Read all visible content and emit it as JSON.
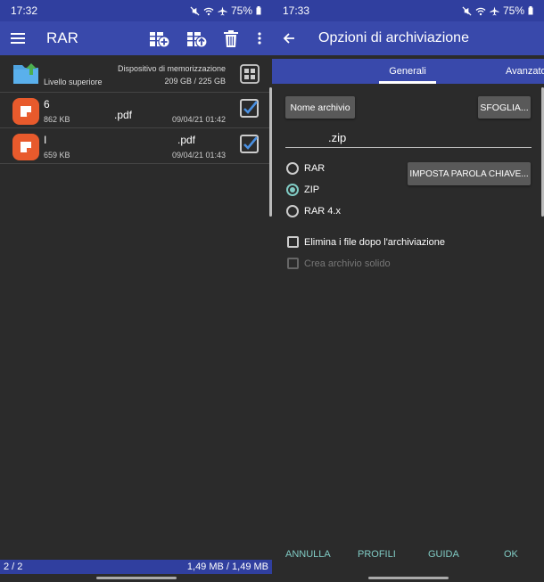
{
  "left": {
    "status": {
      "time": "17:32",
      "battery": "75%"
    },
    "appbar": {
      "title": "RAR"
    },
    "storage": {
      "up_label": "Livello superiore",
      "device_label": "Dispositivo di memorizzazione",
      "space": "209 GB / 225 GB"
    },
    "files": [
      {
        "name_start": "6",
        "name_ext": ".pdf",
        "size": "862 KB",
        "date": "09/04/21 01:42",
        "checked": true
      },
      {
        "name_start": "I",
        "name_ext": ".pdf",
        "size": "659 KB",
        "date": "09/04/21 01:43",
        "checked": true
      }
    ],
    "bottom": {
      "selection": "2 / 2",
      "total": "1,49 MB / 1,49 MB"
    }
  },
  "right": {
    "status": {
      "time": "17:33",
      "battery": "75%"
    },
    "appbar": {
      "title": "Opzioni di archiviazione"
    },
    "tabs": {
      "general": "Generali",
      "advanced": "Avanzato"
    },
    "archive_name_button": "Nome archivio",
    "browse_button": "SFOGLIA...",
    "archive_name_value": ".zip",
    "password_button": "IMPOSTA PAROLA CHIAVE...",
    "formats": [
      {
        "label": "RAR",
        "selected": false
      },
      {
        "label": "ZIP",
        "selected": true
      },
      {
        "label": "RAR 4.x",
        "selected": false
      }
    ],
    "options": [
      {
        "label": "Elimina i file dopo l'archiviazione",
        "checked": false,
        "enabled": true
      },
      {
        "label": "Crea archivio solido",
        "checked": false,
        "enabled": false
      }
    ],
    "footer": {
      "cancel": "ANNULLA",
      "profiles": "PROFILI",
      "help": "GUIDA",
      "ok": "OK"
    }
  },
  "colors": {
    "appbar": "#3949ab",
    "statusbar": "#303f9f",
    "background": "#2b2b2b",
    "accent": "#80cbc4",
    "file_icon": "#e85a2c",
    "check": "#4a90e2"
  }
}
